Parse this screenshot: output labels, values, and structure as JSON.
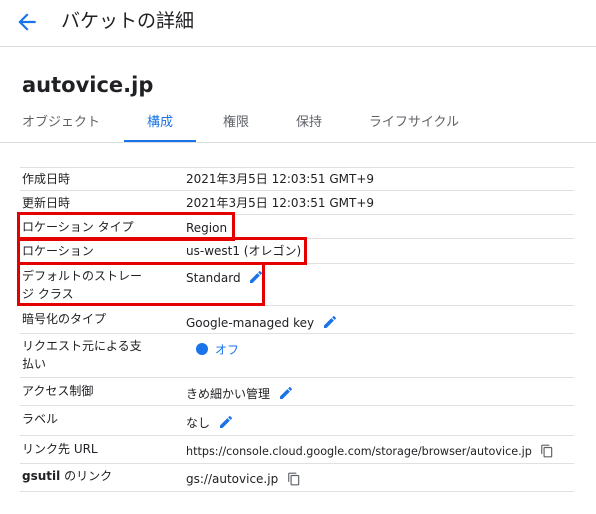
{
  "header": {
    "title": "バケットの詳細"
  },
  "bucket": {
    "name": "autovice.jp"
  },
  "tabs": [
    {
      "label": "オブジェクト"
    },
    {
      "label": "構成"
    },
    {
      "label": "権限"
    },
    {
      "label": "保持"
    },
    {
      "label": "ライフサイクル"
    }
  ],
  "active_tab": "構成",
  "rows": {
    "created": {
      "label": "作成日時",
      "value": "2021年3月5日 12:03:51 GMT+9"
    },
    "updated": {
      "label": "更新日時",
      "value": "2021年3月5日 12:03:51 GMT+9"
    },
    "location_type": {
      "label": "ロケーション タイプ",
      "value": "Region"
    },
    "location": {
      "label": "ロケーション",
      "value": "us-west1 (オレゴン)"
    },
    "storage_class": {
      "label_line1": "デフォルトのストレー",
      "label_line2": "ジ クラス",
      "value": "Standard"
    },
    "encryption": {
      "label": "暗号化のタイプ",
      "value": "Google-managed key"
    },
    "requester_pays": {
      "label_line1": "リクエスト元による支",
      "label_line2": "払い",
      "value": "オフ"
    },
    "access_control": {
      "label": "アクセス制御",
      "value": "きめ細かい管理"
    },
    "labels": {
      "label": "ラベル",
      "value": "なし"
    },
    "link_url": {
      "label": "リンク先 URL",
      "value": "https://console.cloud.google.com/storage/browser/autovice.jp"
    },
    "gsutil": {
      "label_bold": "gsutil",
      "label_rest": " のリンク",
      "value": "gs://autovice.jp"
    }
  },
  "colors": {
    "accent": "#1a73e8",
    "highlight": "#e50000",
    "divider": "#e0e0e0"
  },
  "icons": {
    "back": "arrow-back-icon",
    "edit": "pencil-icon",
    "copy": "copy-icon",
    "toggle": "toggle-dot-icon"
  }
}
